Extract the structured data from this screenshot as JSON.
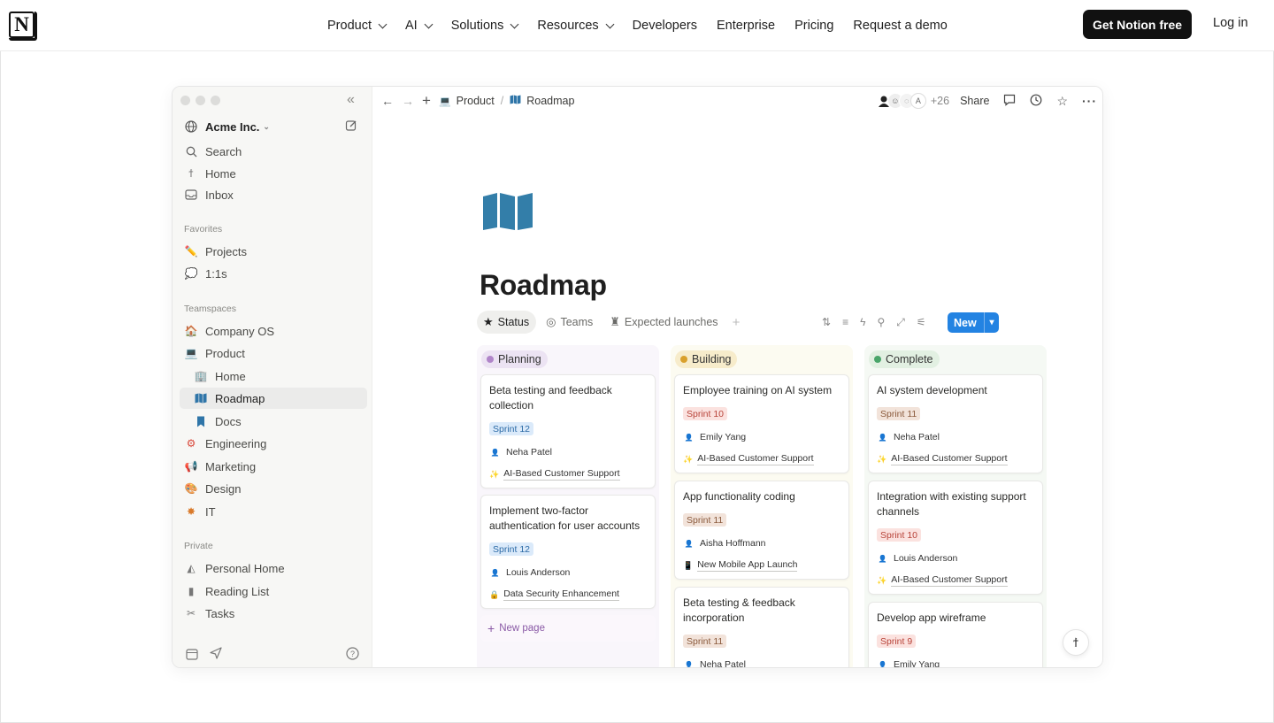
{
  "site_nav": {
    "logo_letter": "N",
    "links": [
      {
        "label": "Product",
        "dropdown": true
      },
      {
        "label": "AI",
        "dropdown": true
      },
      {
        "label": "Solutions",
        "dropdown": true
      },
      {
        "label": "Resources",
        "dropdown": true
      },
      {
        "label": "Developers",
        "dropdown": false
      },
      {
        "label": "Enterprise",
        "dropdown": false
      },
      {
        "label": "Pricing",
        "dropdown": false
      },
      {
        "label": "Request a demo",
        "dropdown": false
      }
    ],
    "cta_label": "Get Notion free",
    "login_label": "Log in"
  },
  "sidebar": {
    "workspace": "Acme Inc.",
    "top_items": [
      {
        "label": "Search",
        "icon": "search-icon"
      },
      {
        "label": "Home",
        "icon": "home-icon"
      },
      {
        "label": "Inbox",
        "icon": "inbox-icon"
      }
    ],
    "favorites_label": "Favorites",
    "favorites": [
      {
        "label": "Projects",
        "icon": "pencil-icon"
      },
      {
        "label": "1:1s",
        "icon": "speech-bubble-icon"
      }
    ],
    "teamspaces_label": "Teamspaces",
    "teamspaces": [
      {
        "label": "Company OS",
        "icon": "house-icon"
      },
      {
        "label": "Product",
        "icon": "laptop-icon"
      },
      {
        "label": "Home",
        "icon": "building-icon"
      },
      {
        "label": "Roadmap",
        "icon": "map-icon"
      },
      {
        "label": "Docs",
        "icon": "bookmark-icon"
      },
      {
        "label": "Engineering",
        "icon": "gear-icon"
      },
      {
        "label": "Marketing",
        "icon": "megaphone-icon"
      },
      {
        "label": "Design",
        "icon": "palette-icon"
      },
      {
        "label": "IT",
        "icon": "bug-icon"
      }
    ],
    "private_label": "Private",
    "private": [
      {
        "label": "Personal Home",
        "icon": "pyramid-icon"
      },
      {
        "label": "Reading List",
        "icon": "book-icon"
      },
      {
        "label": "Tasks",
        "icon": "scissors-icon"
      }
    ]
  },
  "topbar": {
    "breadcrumb": [
      "Product",
      "Roadmap"
    ],
    "avatar_letter": "A",
    "extra_collaborators": "+26",
    "share_label": "Share"
  },
  "page": {
    "title": "Roadmap",
    "views": [
      "Status",
      "Teams",
      "Expected launches"
    ],
    "new_label": "New",
    "new_page_label": "New page"
  },
  "board": {
    "columns": [
      {
        "name": "Planning",
        "color": "#b085c9",
        "bg": "#f9f6fb",
        "head_bg": "#ece3f3",
        "cards": [
          {
            "title": "Beta testing and feedback collection",
            "sprint": "Sprint 12",
            "sprint_color": "blue",
            "person": "Neha Patel",
            "project": "AI-Based Customer Support",
            "project_icon": "sparkle-icon"
          },
          {
            "title": "Implement two-factor authentication for user accounts",
            "sprint": "Sprint 12",
            "sprint_color": "blue",
            "person": "Louis Anderson",
            "project": "Data Security Enhancement",
            "project_icon": "lock-icon"
          }
        ]
      },
      {
        "name": "Building",
        "color": "#d9a02c",
        "bg": "#fcfbf1",
        "head_bg": "#f7eccb",
        "cards": [
          {
            "title": "Employee training on AI system",
            "sprint": "Sprint 10",
            "sprint_color": "red",
            "person": "Emily Yang",
            "project": "AI-Based Customer Support",
            "project_icon": "sparkle-icon"
          },
          {
            "title": "App functionality coding",
            "sprint": "Sprint 11",
            "sprint_color": "brown",
            "person": "Aisha Hoffmann",
            "project": "New Mobile App Launch",
            "project_icon": "phone-icon"
          },
          {
            "title": "Beta testing & feedback incorporation",
            "sprint": "Sprint 11",
            "sprint_color": "brown",
            "person": "Neha Patel",
            "project": "",
            "project_icon": ""
          }
        ]
      },
      {
        "name": "Complete",
        "color": "#4aa56a",
        "bg": "#f5f9f4",
        "head_bg": "#e2f0e2",
        "cards": [
          {
            "title": "AI system development",
            "sprint": "Sprint 11",
            "sprint_color": "brown",
            "person": "Neha Patel",
            "project": "AI-Based Customer Support",
            "project_icon": "sparkle-icon"
          },
          {
            "title": "Integration with existing support channels",
            "sprint": "Sprint 10",
            "sprint_color": "red",
            "person": "Louis Anderson",
            "project": "AI-Based Customer Support",
            "project_icon": "sparkle-icon"
          },
          {
            "title": "Develop app wireframe",
            "sprint": "Sprint 9",
            "sprint_color": "red",
            "person": "Emily Yang",
            "project": "",
            "project_icon": ""
          }
        ]
      }
    ]
  },
  "colors": {
    "accent_blue": "#2383e2",
    "sprint_blue_bg": "#dbeafa",
    "sprint_blue_fg": "#2b6aa6",
    "sprint_red_bg": "#fbe2df",
    "sprint_red_fg": "#b8443a",
    "sprint_brown_bg": "#f2e3da",
    "sprint_brown_fg": "#8a5a3c"
  }
}
